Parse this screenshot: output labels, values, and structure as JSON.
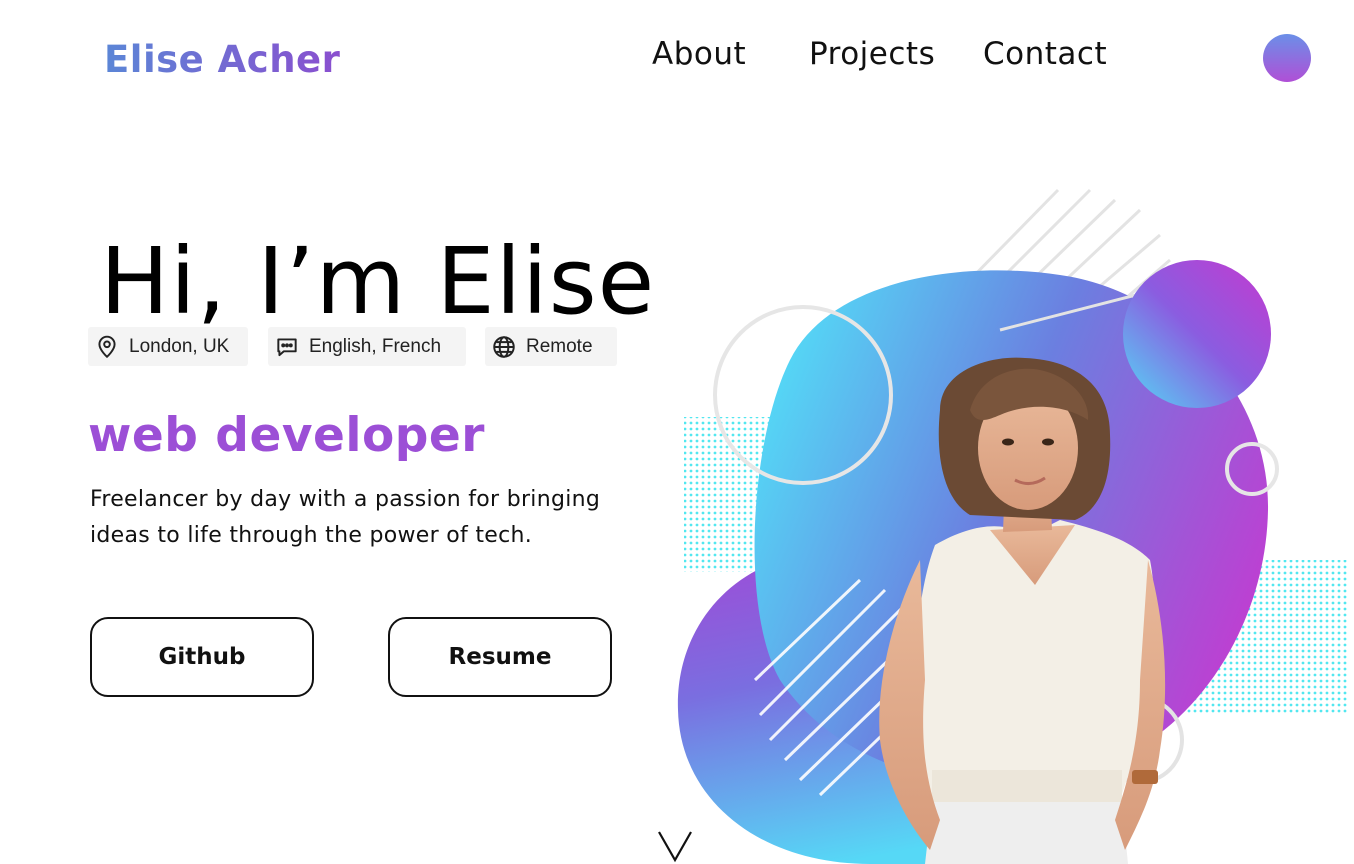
{
  "header": {
    "logo": "Elise Acher",
    "nav": [
      "About",
      "Projects",
      "Contact"
    ]
  },
  "hero": {
    "title": "Hi, I’m Elise",
    "chips": [
      {
        "icon": "location-pin-icon",
        "label": "London, UK"
      },
      {
        "icon": "chat-bubble-icon",
        "label": "English, French"
      },
      {
        "icon": "globe-icon",
        "label": "Remote"
      }
    ],
    "role": "web developer",
    "description": "Freelancer by day with a passion for bringing ideas to life through the power of tech.",
    "buttons": {
      "github": "Github",
      "resume": "Resume"
    }
  },
  "colors": {
    "brand_blue": "#5b86d6",
    "brand_purple": "#9c4fd6",
    "blob_cyan": "#5ad6f5",
    "blob_magenta": "#c63ad2",
    "dots_cyan": "#53e7f0"
  },
  "icons": {
    "theme_toggle": "gradient-circle-icon",
    "scroll": "chevron-down-icon",
    "portrait": "profile-photo"
  }
}
